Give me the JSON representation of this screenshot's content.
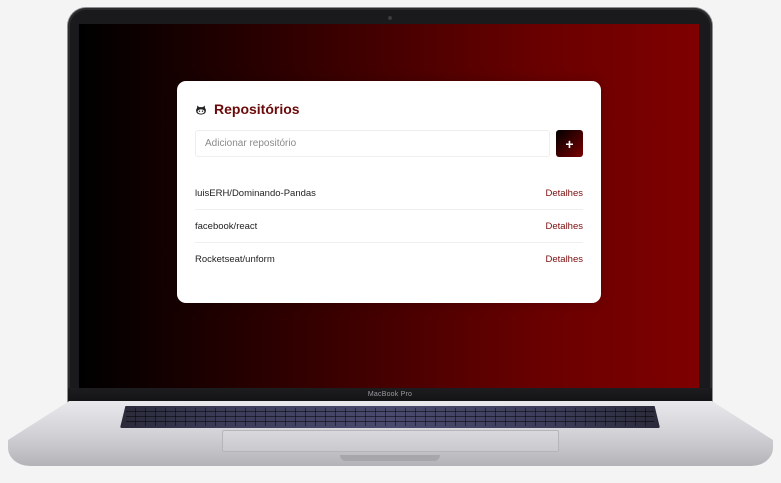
{
  "device": {
    "chin_label": "MacBook Pro"
  },
  "app": {
    "title": "Repositórios",
    "icon": "github-icon",
    "accent_color": "#7a0d0d",
    "search": {
      "placeholder": "Adicionar repositório",
      "value": "",
      "add_label": "+"
    },
    "repositories": [
      {
        "name": "luisERH/Dominando-Pandas",
        "link_label": "Detalhes"
      },
      {
        "name": "facebook/react",
        "link_label": "Detalhes"
      },
      {
        "name": "Rocketseat/unform",
        "link_label": "Detalhes"
      }
    ]
  }
}
